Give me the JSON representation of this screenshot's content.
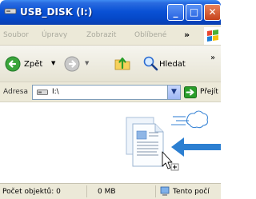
{
  "window": {
    "title": "USB_DISK (I:)",
    "minimize": "_",
    "maximize": "□",
    "close": "✕"
  },
  "menu": {
    "items": [
      "Soubor",
      "Úpravy",
      "Zobrazit",
      "Oblíbené"
    ],
    "overflow": "»"
  },
  "toolbar": {
    "back_label": "Zpět",
    "back_dropdown": "▼",
    "forward_dropdown": "▼",
    "search_label": "Hledat",
    "more": "»"
  },
  "address": {
    "label": "Adresa",
    "value": "I:\\",
    "dropdown": "▼",
    "go_label": "Přejít"
  },
  "status": {
    "objects": "Počet objektů: 0",
    "size": "0 MB",
    "location": "Tento počí"
  },
  "icons": {
    "title": "drive-icon",
    "back": "back-arrow-icon",
    "forward": "forward-arrow-icon",
    "up": "folder-up-icon",
    "search": "search-icon",
    "go": "go-arrow-icon",
    "status_location": "computer-icon",
    "illustration": "document-transfer-icon"
  },
  "colors": {
    "titlebar": "#0a52d6",
    "chrome": "#ece9d8",
    "go_green": "#2a9e2a",
    "arrow_blue": "#2c7fd1"
  }
}
